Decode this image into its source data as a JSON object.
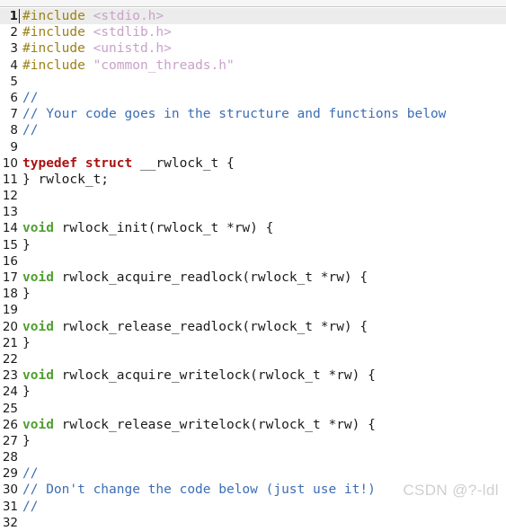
{
  "editor": {
    "background_color": "#ffffff",
    "current_line_highlight_color": "#ececec",
    "top_strip_color": "#f6f6f6",
    "gutter_text_color": "#1a1a1a",
    "current_line_number": 1,
    "total_lines_visible": 32,
    "language": "C",
    "syntax_colors": {
      "preprocessor": "#9b8117",
      "header_include": "#c8a2c8",
      "string": "#c8a2c8",
      "comment": "#3c6eb4",
      "keyword_type_red": "#aa1111",
      "keyword_void_green": "#4f9f2f",
      "plain_text": "#1b1b1b"
    },
    "lines": [
      {
        "n": "1",
        "tokens": [
          {
            "t": "#include",
            "c": "pre"
          },
          {
            "t": " ",
            "c": "plain"
          },
          {
            "t": "<stdio.h>",
            "c": "header"
          }
        ]
      },
      {
        "n": "2",
        "tokens": [
          {
            "t": "#include",
            "c": "pre"
          },
          {
            "t": " ",
            "c": "plain"
          },
          {
            "t": "<stdlib.h>",
            "c": "header"
          }
        ]
      },
      {
        "n": "3",
        "tokens": [
          {
            "t": "#include",
            "c": "pre"
          },
          {
            "t": " ",
            "c": "plain"
          },
          {
            "t": "<unistd.h>",
            "c": "header"
          }
        ]
      },
      {
        "n": "4",
        "tokens": [
          {
            "t": "#include",
            "c": "pre"
          },
          {
            "t": " ",
            "c": "plain"
          },
          {
            "t": "\"common_threads.h\"",
            "c": "string"
          }
        ]
      },
      {
        "n": "5",
        "tokens": []
      },
      {
        "n": "6",
        "tokens": [
          {
            "t": "//",
            "c": "comment"
          }
        ]
      },
      {
        "n": "7",
        "tokens": [
          {
            "t": "// Your code goes in the structure and functions below",
            "c": "comment"
          }
        ]
      },
      {
        "n": "8",
        "tokens": [
          {
            "t": "//",
            "c": "comment"
          }
        ]
      },
      {
        "n": "9",
        "tokens": []
      },
      {
        "n": "10",
        "tokens": [
          {
            "t": "typedef struct",
            "c": "kwred"
          },
          {
            "t": " __rwlock_t {",
            "c": "plain"
          }
        ]
      },
      {
        "n": "11",
        "tokens": [
          {
            "t": "} rwlock_t;",
            "c": "plain"
          }
        ]
      },
      {
        "n": "12",
        "tokens": []
      },
      {
        "n": "13",
        "tokens": []
      },
      {
        "n": "14",
        "tokens": [
          {
            "t": "void",
            "c": "kwgreen"
          },
          {
            "t": " rwlock_init(rwlock_t *rw) {",
            "c": "plain"
          }
        ]
      },
      {
        "n": "15",
        "tokens": [
          {
            "t": "}",
            "c": "plain"
          }
        ]
      },
      {
        "n": "16",
        "tokens": []
      },
      {
        "n": "17",
        "tokens": [
          {
            "t": "void",
            "c": "kwgreen"
          },
          {
            "t": " rwlock_acquire_readlock(rwlock_t *rw) {",
            "c": "plain"
          }
        ]
      },
      {
        "n": "18",
        "tokens": [
          {
            "t": "}",
            "c": "plain"
          }
        ]
      },
      {
        "n": "19",
        "tokens": []
      },
      {
        "n": "20",
        "tokens": [
          {
            "t": "void",
            "c": "kwgreen"
          },
          {
            "t": " rwlock_release_readlock(rwlock_t *rw) {",
            "c": "plain"
          }
        ]
      },
      {
        "n": "21",
        "tokens": [
          {
            "t": "}",
            "c": "plain"
          }
        ]
      },
      {
        "n": "22",
        "tokens": []
      },
      {
        "n": "23",
        "tokens": [
          {
            "t": "void",
            "c": "kwgreen"
          },
          {
            "t": " rwlock_acquire_writelock(rwlock_t *rw) {",
            "c": "plain"
          }
        ]
      },
      {
        "n": "24",
        "tokens": [
          {
            "t": "}",
            "c": "plain"
          }
        ]
      },
      {
        "n": "25",
        "tokens": []
      },
      {
        "n": "26",
        "tokens": [
          {
            "t": "void",
            "c": "kwgreen"
          },
          {
            "t": " rwlock_release_writelock(rwlock_t *rw) {",
            "c": "plain"
          }
        ]
      },
      {
        "n": "27",
        "tokens": [
          {
            "t": "}",
            "c": "plain"
          }
        ]
      },
      {
        "n": "28",
        "tokens": []
      },
      {
        "n": "29",
        "tokens": [
          {
            "t": "//",
            "c": "comment"
          }
        ]
      },
      {
        "n": "30",
        "tokens": [
          {
            "t": "// Don't change the code below (just use it!)",
            "c": "comment"
          }
        ]
      },
      {
        "n": "31",
        "tokens": [
          {
            "t": "//",
            "c": "comment"
          }
        ]
      },
      {
        "n": "32",
        "tokens": []
      }
    ]
  },
  "watermark": {
    "text": "CSDN @?-ldl",
    "color": "#cfcfcf"
  }
}
